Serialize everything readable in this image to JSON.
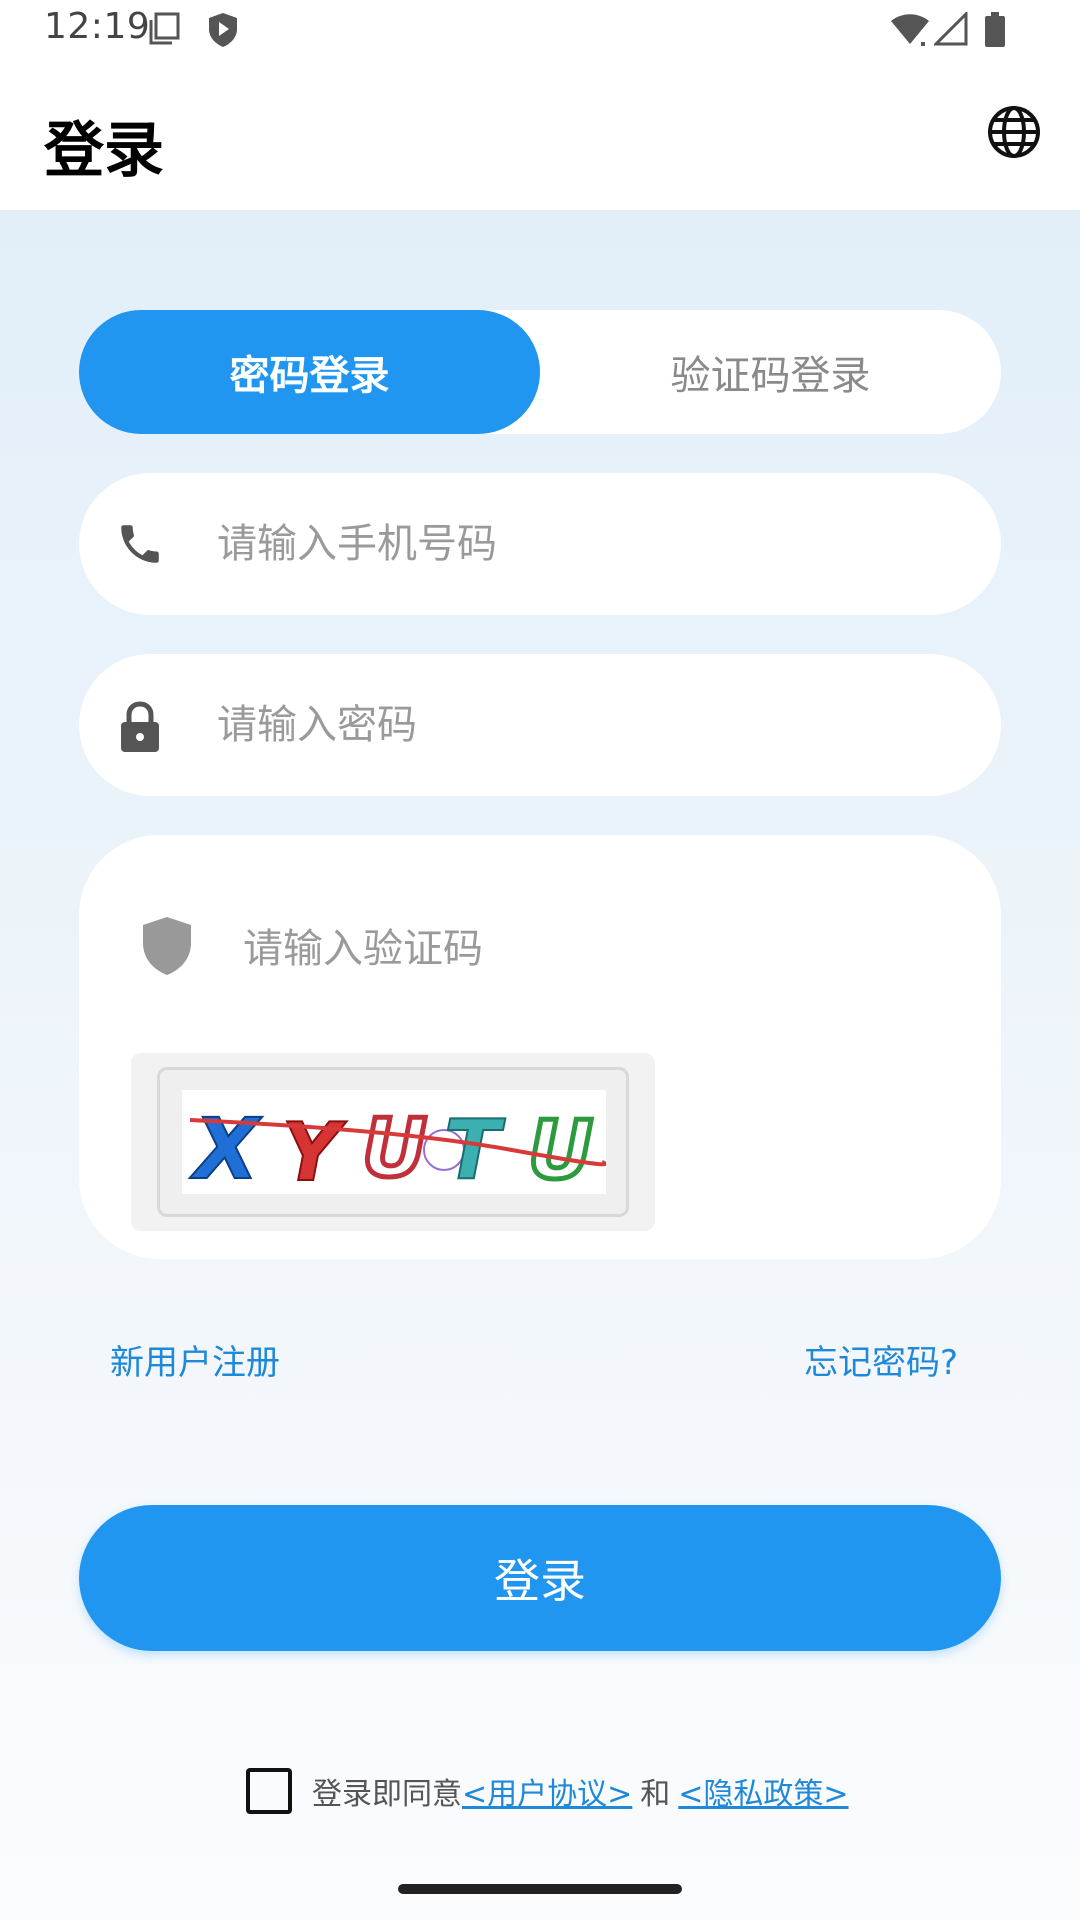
{
  "status_bar": {
    "time": "12:19",
    "icons": [
      "screenshot-icon",
      "shield-play-icon",
      "wifi-icon",
      "signal-icon",
      "battery-icon"
    ]
  },
  "header": {
    "title": "登录",
    "language_icon": "globe-icon"
  },
  "tabs": {
    "password_login": "密码登录",
    "code_login": "验证码登录",
    "active": "password_login"
  },
  "form": {
    "phone_placeholder": "请输入手机号码",
    "password_placeholder": "请输入密码",
    "captcha_placeholder": "请输入验证码",
    "captcha_text": "XYUTU"
  },
  "links": {
    "register": "新用户注册",
    "forgot_password": "忘记密码?"
  },
  "login_button": "登录",
  "agreement": {
    "prefix": "登录即同意",
    "user_agreement": "<用户协议>",
    "and": "和",
    "privacy_policy": "<隐私政策>",
    "checked": false
  },
  "colors": {
    "accent": "#2196f0",
    "link": "#1e88d9",
    "background_top": "#e2eff9"
  }
}
